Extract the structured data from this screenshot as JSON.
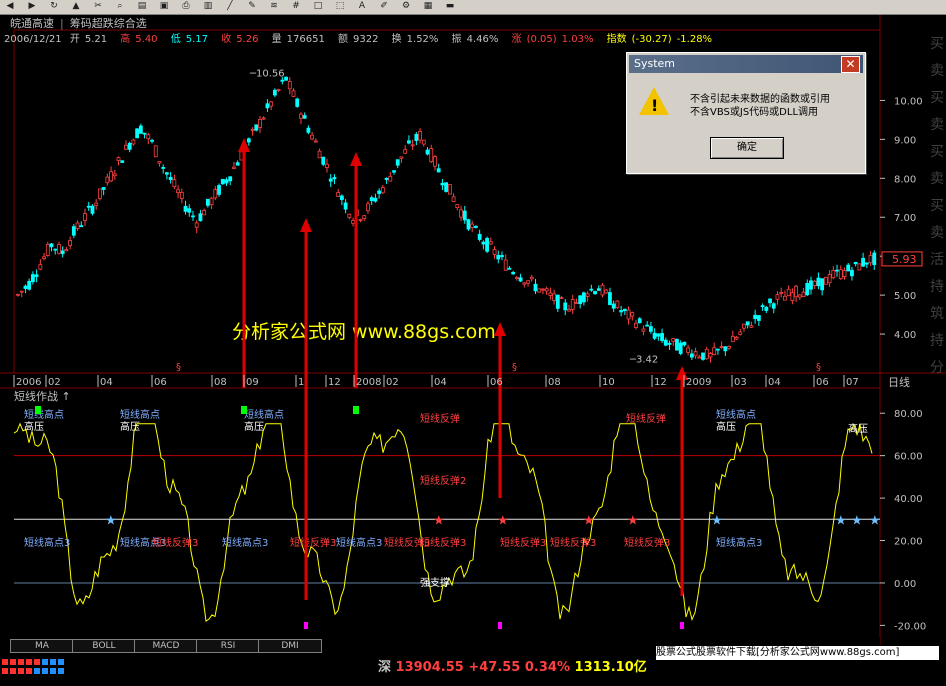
{
  "toolbar": {
    "icons": [
      "back-icon",
      "forward-icon",
      "refresh-icon",
      "alert-icon",
      "tool-icon",
      "zoom-icon",
      "chart-icon",
      "window-icon",
      "print-icon",
      "bars-icon",
      "line-icon",
      "draw-icon",
      "indicator-icon",
      "grid-icon",
      "square-icon",
      "select-icon",
      "text-icon",
      "pen-icon",
      "tool2-icon",
      "color-icon",
      "save-icon"
    ]
  },
  "header": {
    "stock_name": "皖通高速",
    "formula_name": "筹码超跌综合选"
  },
  "quote": {
    "date": "2006/12/21",
    "open_label": "开",
    "open": "5.21",
    "high_label": "高",
    "high": "5.40",
    "low_label": "低",
    "low": "5.17",
    "close_label": "收",
    "close": "5.26",
    "volume_label": "量",
    "volume": "176651",
    "amount_label": "额",
    "amount": "9322",
    "turnover_label": "换",
    "turnover": "1.52%",
    "amplitude_label": "振",
    "amplitude": "4.46%",
    "change_label": "涨",
    "change": "(0.05)",
    "change_pct": "1.03%",
    "index_label": "指数",
    "index_change": "(-30.27)",
    "index_pct": "-1.28%"
  },
  "colors": {
    "up": "#ff4040",
    "down": "#00ffff",
    "yellow": "#ffff00",
    "grid": "#800000",
    "axis": "#c0c0c0",
    "blue_label": "#80b0ff",
    "star_blue": "#70c0ff"
  },
  "main_chart": {
    "y_ticks": [
      "10.00",
      "9.00",
      "8.00",
      "7.00",
      "6.00",
      "5.00",
      "4.00"
    ],
    "y_values": [
      10,
      9,
      8,
      7,
      6,
      5,
      4
    ],
    "ymin": 3.0,
    "ymax": 11.5,
    "current_price": "5.93",
    "peak_label": "10.56",
    "low_label": "3.42",
    "watermark": "分析家公式网 www.88gs.com",
    "right_side_text": "买卖买卖买卖买卖活持筑持分"
  },
  "x_axis": {
    "labels": [
      "2006",
      "02",
      "04",
      "06",
      "08",
      "09",
      "1",
      "12",
      "2008",
      "02",
      "04",
      "06",
      "08",
      "10",
      "12",
      "2009",
      "03",
      "04",
      "06",
      "07"
    ],
    "end_label": "日线"
  },
  "indicator": {
    "title": "短线作战",
    "y_ticks": [
      "80.00",
      "60.00",
      "40.00",
      "20.00",
      "0.00",
      "-20.00"
    ],
    "y_values": [
      80,
      60,
      40,
      20,
      0,
      -20
    ],
    "ymin": -25,
    "ymax": 90,
    "labels_high": [
      "短线高点",
      "高压",
      "短线高点",
      "高压",
      "短线高点",
      "高压",
      "短线高点",
      "高压",
      "高压"
    ],
    "label_rebound": "短线反弹",
    "label_rebound2": "短线反弹2",
    "label_high3": "短线高点3",
    "label_rebound3": "短线反弹3",
    "label_strong_support": "强支撑"
  },
  "tabs": [
    "MA",
    "BOLL",
    "MACD",
    "RSI",
    "DMI"
  ],
  "status": {
    "market": "深",
    "index_value": "13904.55",
    "index_change": "+47.55",
    "index_pct": "0.34%",
    "turnover": "1313.10亿",
    "ad_text": "股票公式股票软件下载[分析家公式网www.88gs.com]"
  },
  "dialog": {
    "title": "System",
    "message_line1": "不含引起未来数据的函数或引用",
    "message_line2": "不含VBS或JS代码或DLL调用",
    "ok_label": "确定"
  },
  "chart_data": {
    "type": "line",
    "title": "",
    "xlabel": "",
    "ylabel": "",
    "ylim": [
      3.0,
      11.5
    ],
    "series": [
      {
        "name": "",
        "values": [
          5.0,
          5.3,
          5.8,
          6.3,
          6.1,
          6.6,
          7.0,
          7.4,
          7.9,
          8.4,
          8.9,
          9.3,
          8.9,
          8.3,
          7.8,
          7.3,
          6.9,
          7.3,
          7.7,
          8.1,
          8.6,
          9.1,
          9.6,
          10.1,
          10.56,
          9.9,
          9.3,
          8.7,
          8.1,
          7.5,
          7.0,
          7.1,
          7.5,
          7.9,
          8.4,
          8.8,
          9.1,
          8.6,
          8.0,
          7.5,
          7.0,
          6.6,
          6.3,
          6.0,
          5.7,
          5.5,
          5.3,
          5.1,
          4.9,
          4.7,
          4.8,
          5.1,
          5.2,
          4.9,
          4.6,
          4.4,
          4.2,
          4.0,
          3.8,
          3.7,
          3.6,
          3.5,
          3.42,
          3.6,
          3.8,
          4.1,
          4.4,
          4.7,
          4.9,
          5.0,
          5.1,
          5.2,
          5.3,
          5.5,
          5.6,
          5.7,
          5.9,
          5.93
        ]
      }
    ]
  }
}
